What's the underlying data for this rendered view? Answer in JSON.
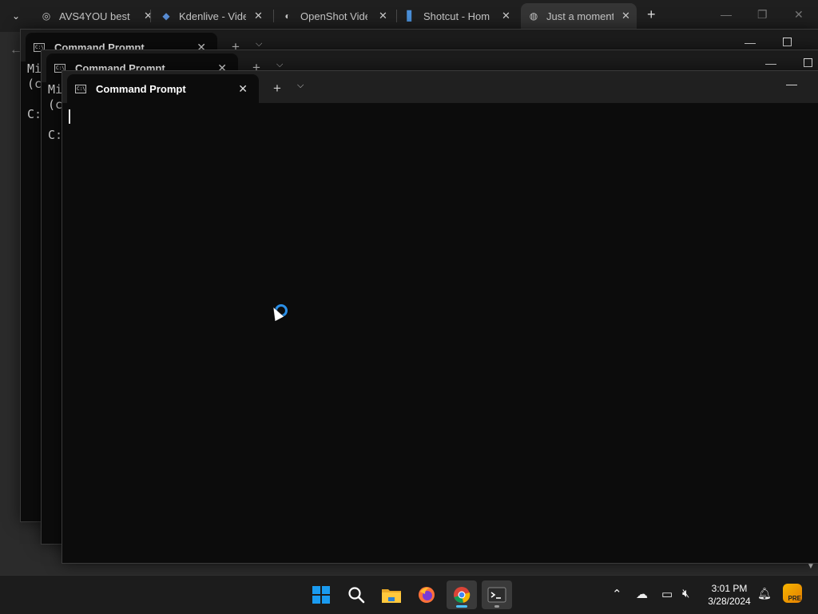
{
  "browser": {
    "tabs": [
      {
        "title": "AVS4YOU best",
        "favicon": "avs-icon"
      },
      {
        "title": "Kdenlive - Vide",
        "favicon": "kdenlive-icon"
      },
      {
        "title": "OpenShot Vide",
        "favicon": "openshot-icon"
      },
      {
        "title": "Shotcut - Hom",
        "favicon": "shotcut-icon"
      },
      {
        "title": "Just a moment.",
        "favicon": "globe-icon",
        "active": true
      }
    ],
    "new_tab_symbol": "+",
    "close_symbol": "✕"
  },
  "terminals": {
    "back": {
      "title": "Command Prompt",
      "lines": [
        "Mi",
        "(c",
        "",
        "C:"
      ]
    },
    "middle": {
      "title": "Command Prompt",
      "lines": [
        "Mi",
        "(c",
        "",
        "C:"
      ]
    },
    "front": {
      "title": "Command Prompt",
      "lines": []
    }
  },
  "taskbar": {
    "clock_time": "3:01 PM",
    "clock_date": "3/28/2024",
    "apps": [
      "start-icon",
      "search-icon",
      "file-explorer-icon",
      "firefox-icon",
      "chrome-icon",
      "terminal-icon"
    ],
    "copilot_badge": "PRE"
  },
  "colors": {
    "accent": "#4cc2ff",
    "busy_ring": "#2a8fe8",
    "terminal_bg": "#0c0c0c"
  }
}
